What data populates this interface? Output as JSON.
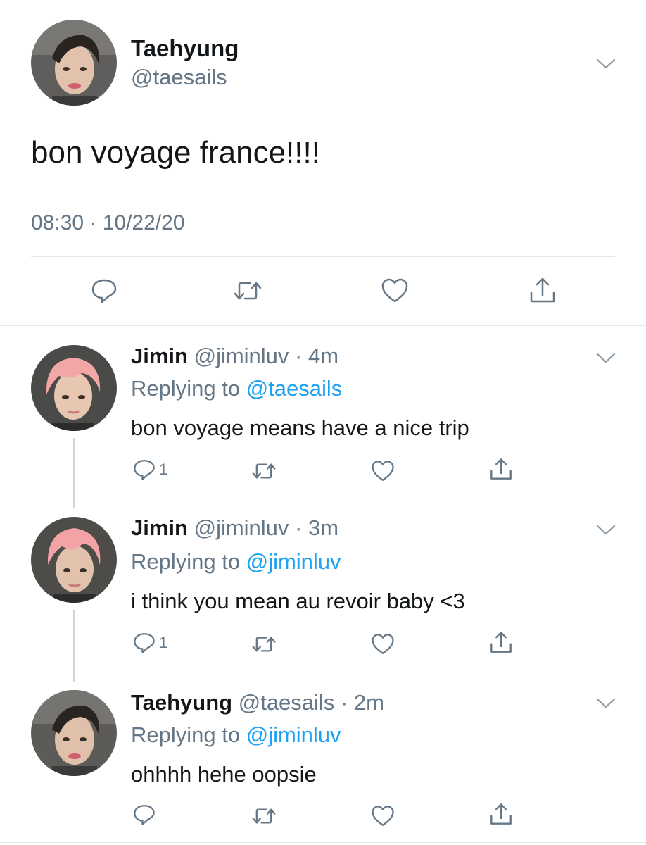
{
  "main_tweet": {
    "name": "Taehyung",
    "handle": "@taesails",
    "text": "bon voyage france!!!!",
    "timestamp": "08:30 · 10/22/20",
    "actions": [
      "comment-icon",
      "retweet-icon",
      "like-icon",
      "share-icon"
    ]
  },
  "replies": [
    {
      "name": "Jimin",
      "handle": "@jiminluv",
      "separator": "·",
      "time": "4m",
      "replying_prefix": "Replying to",
      "replying_to": "@taesails",
      "text": "bon voyage means have a nice trip",
      "reply_count": "1"
    },
    {
      "name": "Jimin",
      "handle": "@jiminluv",
      "separator": "·",
      "time": "3m",
      "replying_prefix": "Replying to",
      "replying_to": "@jiminluv",
      "text": "i think you mean au revoir baby <3",
      "reply_count": "1"
    },
    {
      "name": "Taehyung",
      "handle": "@taesails",
      "separator": "·",
      "time": "2m",
      "replying_prefix": "Replying to",
      "replying_to": "@jiminluv",
      "text": "ohhhh hehe oopsie",
      "reply_count": ""
    }
  ],
  "colors": {
    "text": "#14171a",
    "secondary": "#657786",
    "accent": "#1da1f2",
    "divider": "#e1e8ed"
  }
}
